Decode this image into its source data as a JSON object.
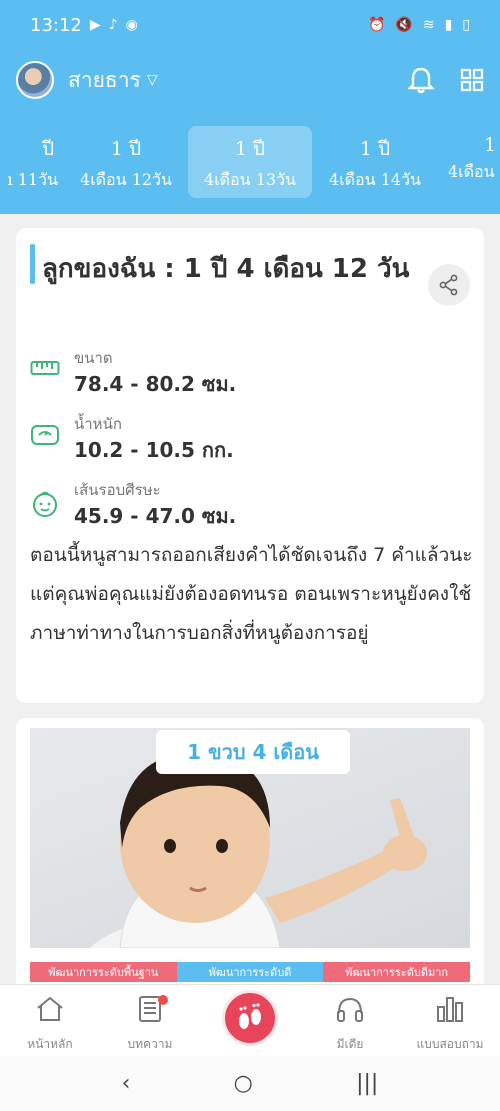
{
  "status_bar": {
    "time": "13:12",
    "left_icons": [
      "youtube-icon",
      "tiktok-icon",
      "location-icon"
    ],
    "right_icons": [
      "alarm-icon",
      "mute-icon",
      "wifi-icon",
      "signal-icon",
      "battery-icon"
    ]
  },
  "header": {
    "profile_name": "สายธาร",
    "icons": [
      "bell-icon",
      "grid-icon"
    ]
  },
  "age_tabs": [
    {
      "year": "ปี",
      "detail": "ı 11วัน"
    },
    {
      "year": "1 ปี",
      "detail": "4เดือน 12วัน"
    },
    {
      "year": "1 ปี",
      "detail": "4เดือน 13วัน",
      "active": true
    },
    {
      "year": "1 ปี",
      "detail": "4เดือน 14วัน"
    },
    {
      "year": "1",
      "detail": "4เดือน"
    }
  ],
  "card": {
    "title": "ลูกของฉัน : 1  ปี 4 เดือน 12 วัน",
    "metrics": [
      {
        "label": "ขนาด",
        "value": "78.4 - 80.2 ซม.",
        "icon": "ruler-icon"
      },
      {
        "label": "น้ำหนัก",
        "value": "10.2 - 10.5 กก.",
        "icon": "scale-icon"
      },
      {
        "label": "เส้นรอบศีรษะ",
        "value": "45.9 - 47.0 ซม.",
        "icon": "baby-face-icon"
      }
    ],
    "description": "ตอนนี้หนูสามารถออกเสียงคำได้ชัดเจนถึง 7 คำแล้วนะ แต่คุณพ่อคุณแม่ยังต้องอดทนรอ ตอนเพราะหนูยังคงใช้ ภาษาท่าทางในการบอกสิ่งที่หนูต้องการอยู่"
  },
  "image_card": {
    "badge": "1 ขวบ 4 เดือน",
    "dev_levels": [
      {
        "label": "พัฒนาการระดับพื้นฐาน",
        "color": "#ef6b7a"
      },
      {
        "label": "พัฒนาการระดับดี",
        "color": "#5bbdf0"
      },
      {
        "label": "พัฒนาการระดับดีมาก",
        "color": "#ef6b7a"
      }
    ]
  },
  "bottom_nav": [
    {
      "label": "หน้าหลัก",
      "icon": "home-icon"
    },
    {
      "label": "บทความ",
      "icon": "article-icon",
      "badge_dot": true
    },
    {
      "label": "",
      "icon": "feet-icon"
    },
    {
      "label": "มีเดีย",
      "icon": "headphones-icon"
    },
    {
      "label": "แบบสอบถาม",
      "icon": "bar-chart-icon"
    }
  ],
  "android_nav": {
    "back": "‹",
    "home": "○",
    "recents": "|||"
  },
  "colors": {
    "primary": "#5bbdf0",
    "accent": "#e8455a",
    "pink": "#ef6b7a",
    "icon_green": "#3fb57a"
  }
}
